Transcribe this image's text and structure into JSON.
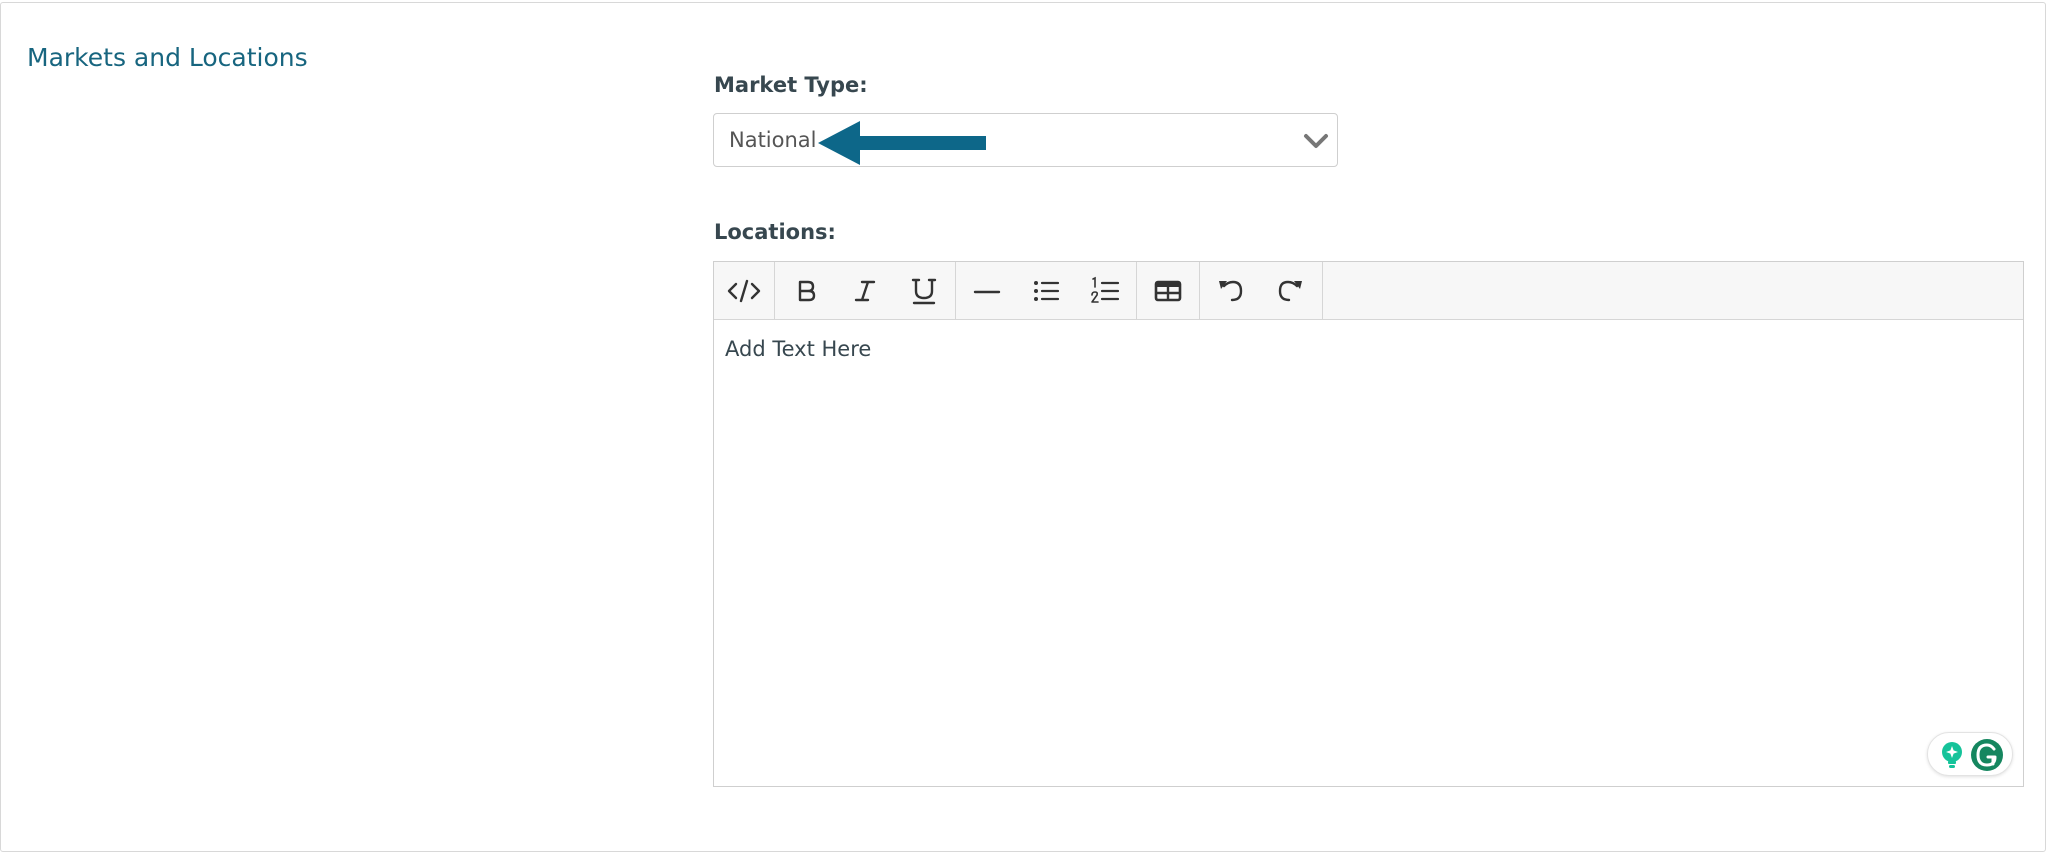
{
  "section": {
    "title": "Markets and Locations"
  },
  "market_type": {
    "label": "Market Type:",
    "selected": "National"
  },
  "locations": {
    "label": "Locations:",
    "placeholder": "Add Text Here"
  },
  "toolbar": {
    "buttons": [
      {
        "icon": "code-icon",
        "tooltip": "Code View"
      },
      {
        "icon": "bold-icon",
        "tooltip": "Bold"
      },
      {
        "icon": "italic-icon",
        "tooltip": "Italic"
      },
      {
        "icon": "underline-icon",
        "tooltip": "Underline"
      },
      {
        "icon": "horizontal-rule-icon",
        "tooltip": "Horizontal Rule"
      },
      {
        "icon": "unordered-list-icon",
        "tooltip": "Unordered List"
      },
      {
        "icon": "ordered-list-icon",
        "tooltip": "Ordered List"
      },
      {
        "icon": "table-icon",
        "tooltip": "Table"
      },
      {
        "icon": "undo-icon",
        "tooltip": "Undo"
      },
      {
        "icon": "redo-icon",
        "tooltip": "Redo"
      }
    ]
  },
  "colors": {
    "accent": "#17657f",
    "label_text": "#37474f",
    "border": "#cfcfcf",
    "toolbar_bg": "#f7f7f7",
    "grammarly_green": "#15c39a"
  }
}
